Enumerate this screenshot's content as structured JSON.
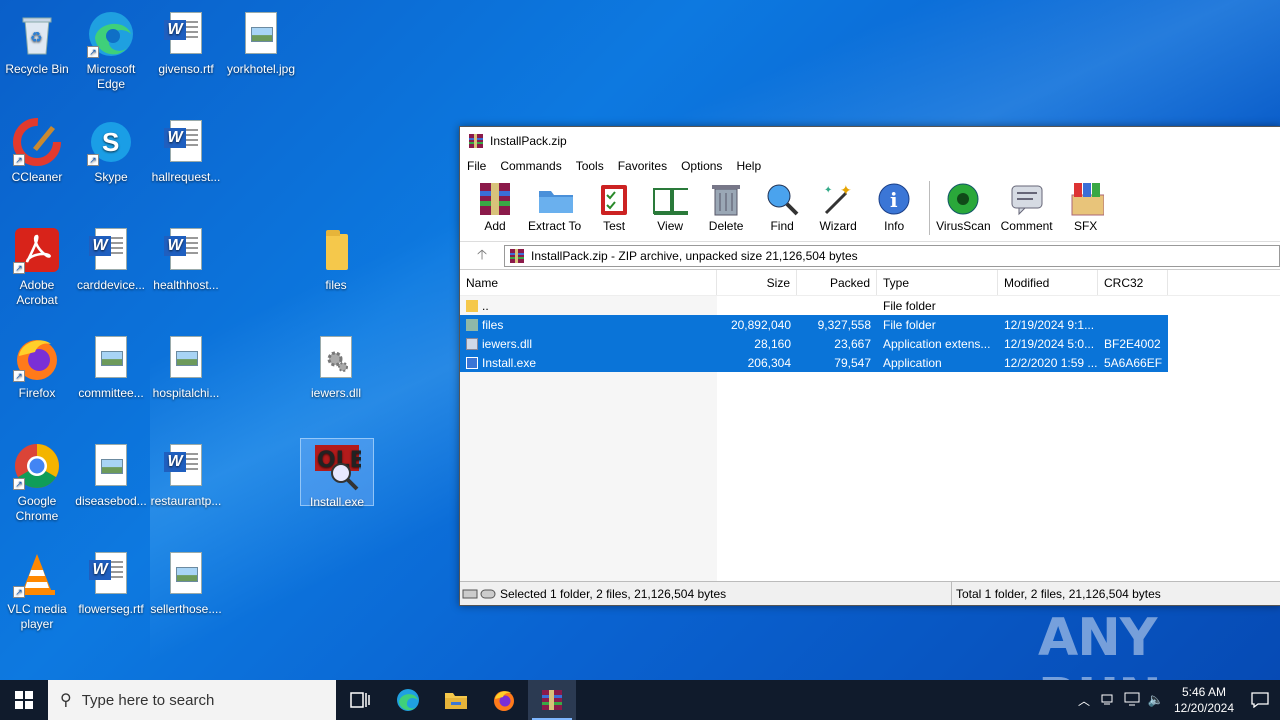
{
  "desktop": {
    "icons": [
      {
        "label": "Recycle Bin"
      },
      {
        "label": "Microsoft Edge"
      },
      {
        "label": "givenso.rtf"
      },
      {
        "label": "yorkhotel.jpg"
      },
      {
        "label": "CCleaner"
      },
      {
        "label": "Skype"
      },
      {
        "label": "hallrequest..."
      },
      {
        "label": "Adobe Acrobat"
      },
      {
        "label": "carddevice..."
      },
      {
        "label": "healthhost..."
      },
      {
        "label": "files"
      },
      {
        "label": "Firefox"
      },
      {
        "label": "committee..."
      },
      {
        "label": "hospitalchi..."
      },
      {
        "label": "iewers.dll"
      },
      {
        "label": "Google Chrome"
      },
      {
        "label": "diseasebod..."
      },
      {
        "label": "restaurantp..."
      },
      {
        "label": "Install.exe"
      },
      {
        "label": "VLC media player"
      },
      {
        "label": "flowerseg.rtf"
      },
      {
        "label": "sellerthose...."
      }
    ]
  },
  "window": {
    "title": "InstallPack.zip",
    "menu": [
      "File",
      "Commands",
      "Tools",
      "Favorites",
      "Options",
      "Help"
    ],
    "toolbar": [
      "Add",
      "Extract To",
      "Test",
      "View",
      "Delete",
      "Find",
      "Wizard",
      "Info",
      "VirusScan",
      "Comment",
      "SFX"
    ],
    "address": "InstallPack.zip - ZIP archive, unpacked size 21,126,504 bytes",
    "columns": {
      "name": "Name",
      "size": "Size",
      "packed": "Packed",
      "type": "Type",
      "modified": "Modified",
      "crc": "CRC32"
    },
    "rows": [
      {
        "name": "..",
        "size": "",
        "packed": "",
        "type": "File folder",
        "modified": "",
        "crc": ""
      },
      {
        "name": "files",
        "size": "20,892,040",
        "packed": "9,327,558",
        "type": "File folder",
        "modified": "12/19/2024 9:1...",
        "crc": ""
      },
      {
        "name": "iewers.dll",
        "size": "28,160",
        "packed": "23,667",
        "type": "Application extens...",
        "modified": "12/19/2024 5:0...",
        "crc": "BF2E4002"
      },
      {
        "name": "Install.exe",
        "size": "206,304",
        "packed": "79,547",
        "type": "Application",
        "modified": "12/2/2020 1:59 ...",
        "crc": "5A6A66EF"
      }
    ],
    "status_left": "Selected 1 folder, 2 files, 21,126,504 bytes",
    "status_right": "Total 1 folder, 2 files, 21,126,504 bytes"
  },
  "taskbar": {
    "search_placeholder": "Type here to search",
    "time": "5:46 AM",
    "date": "12/20/2024"
  },
  "watermark": "ANY RUN",
  "colors": {
    "selection": "#0a74d8",
    "taskbar": "#101b2c",
    "desktop": "#0a6fd8"
  }
}
